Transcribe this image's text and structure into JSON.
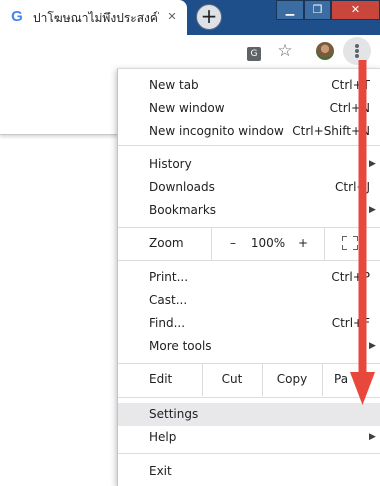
{
  "tab": {
    "title": "ปาโฆษณาไม่พึงประสงค์ใ",
    "favicon": "G",
    "close": "✕"
  },
  "window": {
    "min": "▁",
    "max": "❐",
    "close": "✕",
    "new_tab": "+"
  },
  "toolbar": {
    "translate_glyph": "G",
    "star": "☆"
  },
  "menu": {
    "new_tab": {
      "label": "New tab",
      "shortcut": "Ctrl+T"
    },
    "new_window": {
      "label": "New window",
      "shortcut": "Ctrl+N"
    },
    "incognito": {
      "label": "New incognito window",
      "shortcut": "Ctrl+Shift+N"
    },
    "history": {
      "label": "History"
    },
    "downloads": {
      "label": "Downloads",
      "shortcut": "Ctrl+J"
    },
    "bookmarks": {
      "label": "Bookmarks"
    },
    "zoom": {
      "label": "Zoom",
      "minus": "–",
      "value": "100%",
      "plus": "+"
    },
    "print": {
      "label": "Print...",
      "shortcut": "Ctrl+P"
    },
    "cast": {
      "label": "Cast..."
    },
    "find": {
      "label": "Find...",
      "shortcut": "Ctrl+F"
    },
    "more_tools": {
      "label": "More tools"
    },
    "edit": {
      "label": "Edit",
      "cut": "Cut",
      "copy": "Copy",
      "paste": "Pa"
    },
    "settings": {
      "label": "Settings"
    },
    "help": {
      "label": "Help"
    },
    "exit": {
      "label": "Exit"
    },
    "submenu_arrow": "▶"
  },
  "colors": {
    "title_bar": "#1f4f8a",
    "annotation_arrow": "#e8473b",
    "highlight": "#e8e8ea"
  }
}
